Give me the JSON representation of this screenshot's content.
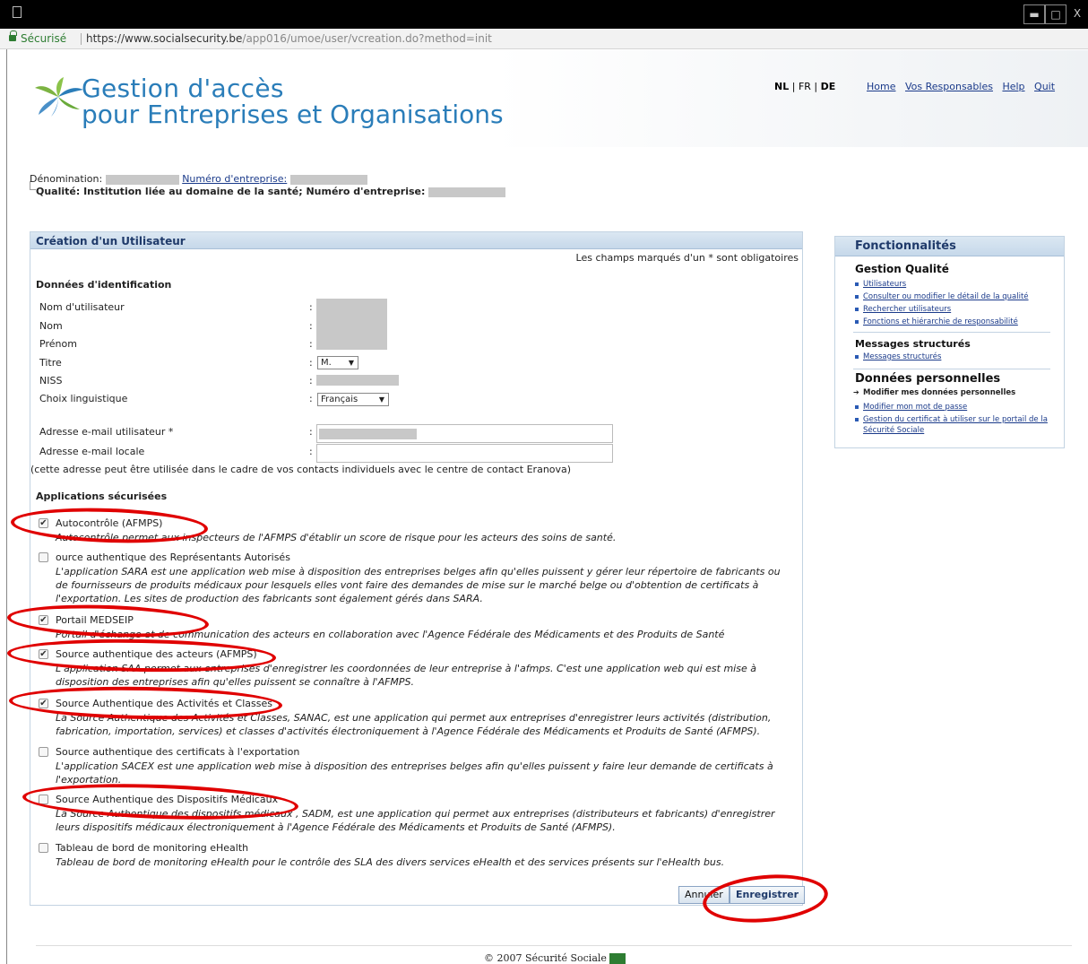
{
  "browser": {
    "secure_label": "Sécurisé",
    "url_base": "https://www.socialsecurity.be",
    "url_path": "/app016/umoe/user/vcreation.do?method=init"
  },
  "header": {
    "title_line1": "Gestion d'accès",
    "title_line2": "pour Entreprises et Organisations",
    "lang": {
      "nl": "NL",
      "fr": "FR",
      "de": "DE",
      "sep": "|"
    },
    "links": [
      "Home",
      "Vos Responsables",
      "Help",
      "Quit"
    ]
  },
  "entity": {
    "denomination_label": "Dénomination:",
    "numero_link": "Numéro d'entreprise:",
    "qualite": "Qualité: Institution liée au domaine de la santé; Numéro d'entreprise:"
  },
  "form": {
    "title": "Création d'un Utilisateur",
    "mandatory_note": "Les champs marqués d'un * sont obligatoires",
    "id_section": "Données d'identification",
    "fields": {
      "username": "Nom d'utilisateur",
      "nom": "Nom",
      "prenom": "Prénom",
      "titre": "Titre",
      "niss": "NISS",
      "langue": "Choix linguistique",
      "email": "Adresse e-mail utilisateur *",
      "email_local": "Adresse e-mail locale"
    },
    "colon": ":",
    "titre_value": "M.",
    "langue_value": "Français",
    "note": "(cette adresse peut être utilisée dans le cadre de vos contacts individuels avec le centre de contact Eranova)",
    "apps_section": "Applications sécurisées",
    "apps": [
      {
        "title": "Autocontrôle (AFMPS)",
        "checked": true,
        "desc": "Autocontrôle permet aux inspecteurs de l'AFMPS d'établir un score de risque pour les acteurs des soins de santé."
      },
      {
        "title": "ource authentique des Représentants Autorisés",
        "checked": false,
        "desc": "L'application SARA est une application web mise à disposition des entreprises belges afin qu'elles puissent y gérer leur répertoire de fabricants ou de fournisseurs de produits médicaux pour lesquels elles vont faire des demandes de mise sur le marché belge ou d'obtention de certificats à l'exportation. Les sites de production des fabricants sont également gérés dans SARA."
      },
      {
        "title": "Portail MEDSEIP",
        "checked": true,
        "desc": "Portail d'échange et de communication des acteurs en collaboration avec l'Agence Fédérale des Médicaments et des Produits de Santé"
      },
      {
        "title": "Source authentique des acteurs (AFMPS)",
        "checked": true,
        "desc": "L'application SAA permet aux entreprises d'enregistrer les coordonnées de leur entreprise à l'afmps. C'est une application web qui est mise à disposition des entreprises afin qu'elles puissent se connaître à l'AFMPS."
      },
      {
        "title": "Source Authentique des Activités et Classes",
        "checked": true,
        "desc": "La Source Authentique des Activités et Classes, SANAC, est une application qui permet aux entreprises d'enregistrer leurs activités (distribution, fabrication, importation, services) et classes d'activités électroniquement à l'Agence Fédérale des Médicaments et Produits de Santé (AFMPS)."
      },
      {
        "title": "Source authentique des certificats à l'exportation",
        "checked": false,
        "desc": "L'application SACEX est une application web mise à disposition des entreprises belges afin qu'elles puissent y faire leur demande de certificats à l'exportation."
      },
      {
        "title": "Source Authentique des Dispositifs Médicaux",
        "checked": false,
        "desc": "La Source Authentique des dispositifs médicaux , SADM, est une application qui permet aux entreprises (distributeurs et fabricants) d'enregistrer leurs dispositifs médicaux électroniquement à l'Agence Fédérale des Médicaments et Produits de Santé (AFMPS)."
      },
      {
        "title": "Tableau de bord de monitoring eHealth",
        "checked": false,
        "desc": "Tableau de bord de monitoring eHealth pour le contrôle des SLA des divers services eHealth et des services présents sur l'eHealth bus."
      }
    ],
    "cancel_label": "Annuler",
    "save_label": "Enregistrer"
  },
  "sidebar": {
    "title": "Fonctionnalités",
    "g1_title": "Gestion Qualité",
    "g1_links": [
      "Utilisateurs",
      "Consulter ou modifier le détail de la qualité",
      "Rechercher utilisateurs",
      "Fonctions et hiérarchie de responsabilité"
    ],
    "g2_title": "Messages structurés",
    "g2_links": [
      "Messages structurés"
    ],
    "g3_title": "Données personnelles",
    "g3_current": "Modifier mes données personnelles",
    "g3_links": [
      "Modifier mon mot de passe",
      "Gestion du certificat à utiliser sur le portail de la Sécurité Sociale"
    ]
  },
  "footer": {
    "text": "© 2007 Sécurité Sociale"
  },
  "colors": {
    "accent": "#2a7db9",
    "annotation": "#e00000"
  }
}
